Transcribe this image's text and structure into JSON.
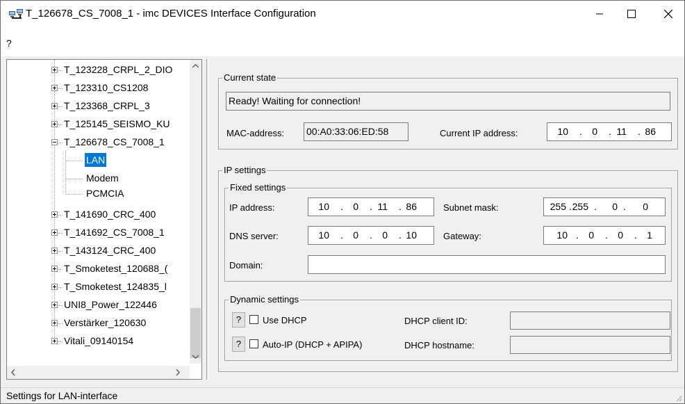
{
  "window": {
    "title": "T_126678_CS_7008_1 - imc DEVICES Interface Configuration",
    "app_icon": "network-computers-icon",
    "controls": {
      "minimize_icon": "minimize-icon",
      "maximize_icon": "maximize-icon",
      "close_icon": "close-icon"
    }
  },
  "menu": {
    "help": "?"
  },
  "tree": {
    "items": [
      {
        "label": "T_123228_CRPL_2_DIO",
        "expanded": false
      },
      {
        "label": "T_123310_CS1208",
        "expanded": false
      },
      {
        "label": "T_123368_CRPL_3",
        "expanded": false
      },
      {
        "label": "T_125145_SEISMO_KU",
        "expanded": false
      },
      {
        "label": "T_126678_CS_7008_1",
        "expanded": true,
        "children": [
          "LAN",
          "Modem",
          "PCMCIA"
        ],
        "selected_child": "LAN"
      },
      {
        "label": "T_141690_CRC_400",
        "expanded": false
      },
      {
        "label": "T_141692_CS_7008_1",
        "expanded": false
      },
      {
        "label": "T_143124_CRC_400",
        "expanded": false
      },
      {
        "label": "T_Smoketest_120688_(",
        "expanded": false
      },
      {
        "label": "T_Smoketest_124835_l",
        "expanded": false
      },
      {
        "label": "UNI8_Power_122446",
        "expanded": false
      },
      {
        "label": "Verstärker_120630",
        "expanded": false
      },
      {
        "label": "Vitali_09140154",
        "expanded": false
      }
    ]
  },
  "current_state": {
    "group_label": "Current state",
    "status_text": "Ready! Waiting for connection!",
    "mac_label": "MAC-address:",
    "mac_value": "00:A0:33:06:ED:58",
    "current_ip_label": "Current IP address:",
    "current_ip": [
      "10",
      "0",
      "11",
      "86"
    ]
  },
  "ip_settings": {
    "group_label": "IP settings",
    "fixed": {
      "group_label": "Fixed settings",
      "ip_label": "IP address:",
      "ip": [
        "10",
        "0",
        "11",
        "86"
      ],
      "subnet_label": "Subnet mask:",
      "subnet": [
        "255",
        "255",
        "0",
        "0"
      ],
      "dns_label": "DNS server:",
      "dns": [
        "10",
        "0",
        "0",
        "10"
      ],
      "gateway_label": "Gateway:",
      "gateway": [
        "10",
        "0",
        "0",
        "1"
      ],
      "domain_label": "Domain:",
      "domain_value": ""
    },
    "dynamic": {
      "group_label": "Dynamic settings",
      "help_button": "?",
      "use_dhcp_label": "Use DHCP",
      "use_dhcp_checked": false,
      "auto_ip_label": "Auto-IP (DHCP + APIPA)",
      "auto_ip_checked": false,
      "client_id_label": "DHCP client ID:",
      "client_id_value": "",
      "hostname_label": "DHCP hostname:",
      "hostname_value": ""
    }
  },
  "status_bar": {
    "text": "Settings for LAN-interface"
  }
}
